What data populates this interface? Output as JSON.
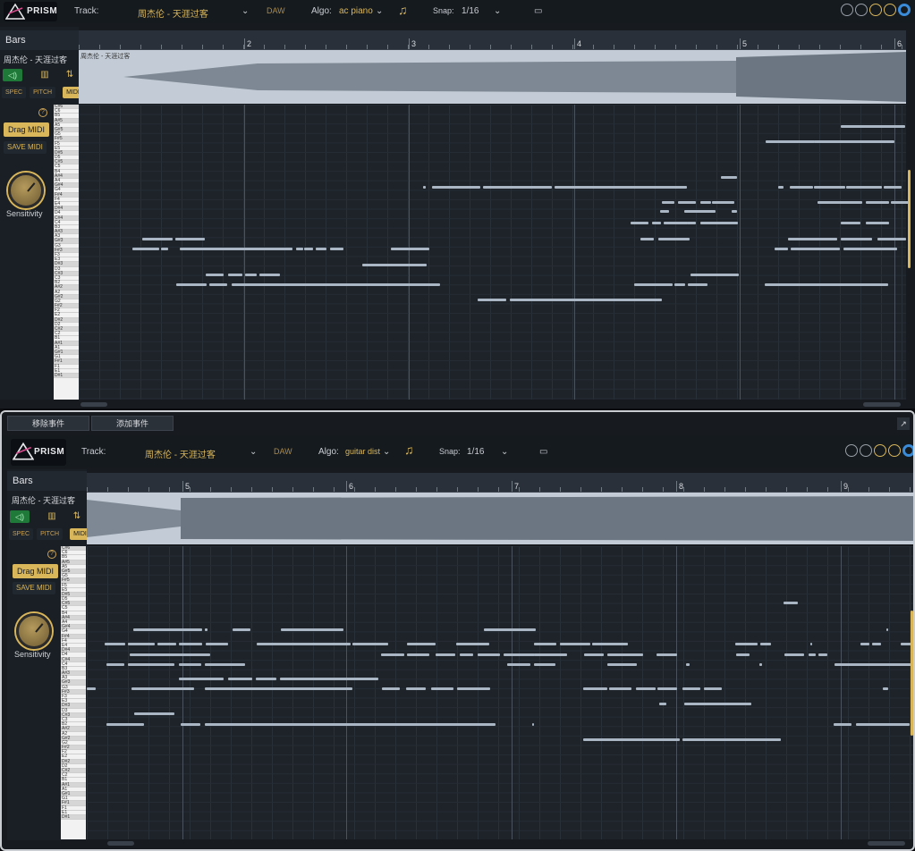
{
  "panels": [
    {
      "track_label": "Track:",
      "track_name": "周杰伦 - 天涯过客",
      "daw": "DAW",
      "algo_label": "Algo:",
      "algo": "ac piano",
      "snap_label": "Snap:",
      "snap": "1/16",
      "bars_label": "Bars",
      "track_short": "周杰伦 - 天涯过客",
      "spec": "SPEC",
      "pitch": "PITCH",
      "midi": "MIDI",
      "drag_midi": "Drag MIDI",
      "save_midi": "SAVE MIDI",
      "sensitivity": "Sensitivity",
      "bar_numbers": [
        "2",
        "3",
        "4",
        "5",
        "6"
      ],
      "logo": "PRISM"
    },
    {
      "track_label": "Track:",
      "track_name": "周杰伦 - 天涯过客",
      "daw": "DAW",
      "algo_label": "Algo:",
      "algo": "guitar dist",
      "snap_label": "Snap:",
      "snap": "1/16",
      "bars_label": "Bars",
      "track_short": "周杰伦 - 天涯过客",
      "spec": "SPEC",
      "pitch": "PITCH",
      "midi": "MIDI",
      "drag_midi": "Drag MIDI",
      "save_midi": "SAVE MIDI",
      "sensitivity": "Sensitivity",
      "bar_numbers": [
        "5",
        "6",
        "7",
        "8",
        "9"
      ],
      "logo": "PRISM"
    }
  ],
  "tabs": {
    "remove": "移除事件",
    "add": "添加事件"
  },
  "key_labels": [
    "C#6",
    "C6",
    "B5",
    "A#5",
    "A5",
    "G#5",
    "G5",
    "F#5",
    "F5",
    "E5",
    "D#5",
    "D5",
    "C#5",
    "C5",
    "B4",
    "A#4",
    "A4",
    "G#4",
    "G4",
    "F#4",
    "F4",
    "E4",
    "D#4",
    "D4",
    "C#4",
    "C4",
    "B3",
    "A#3",
    "A3",
    "G#3",
    "G3",
    "F#3",
    "F3",
    "E3",
    "D#3",
    "D3",
    "C#3",
    "C3",
    "B2",
    "A#2",
    "A2",
    "G#2",
    "G2",
    "F#2",
    "F2",
    "E2",
    "D#2",
    "D2",
    "C#2",
    "C2",
    "B1",
    "A#1",
    "A1",
    "G#1",
    "G1",
    "F#1",
    "F1",
    "E1",
    "D#1"
  ],
  "colors": {
    "accent": "#d9b65a",
    "note": "#aab6c3",
    "grid": "#1e232a"
  }
}
